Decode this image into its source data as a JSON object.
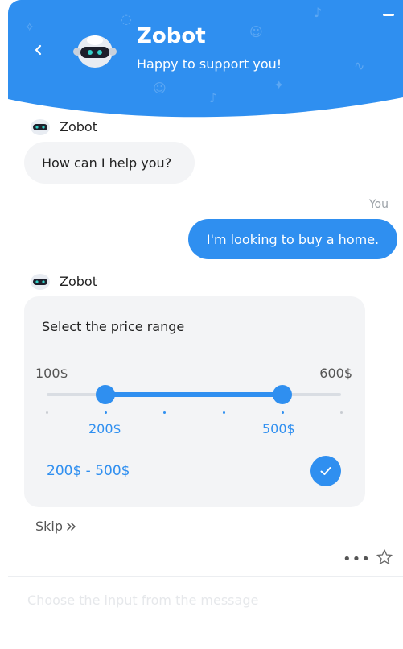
{
  "header": {
    "title": "Zobot",
    "subtitle": "Happy to support you!",
    "back_icon": "chevron-left-icon",
    "minimize_icon": "minimize-icon",
    "color": "#2f8ff0"
  },
  "messages": {
    "bot_name_1": "Zobot",
    "bot_text_1": "How can I help you?",
    "user_label": "You",
    "user_text": "I'm looking to buy a home.",
    "bot_name_2": "Zobot"
  },
  "range": {
    "title": "Select the price range",
    "min_label": "100$",
    "max_label": "600$",
    "min": 100,
    "max": 600,
    "low": 200,
    "high": 500,
    "low_label": "200$",
    "high_label": "500$",
    "summary": "200$ - 500$",
    "ticks": [
      100,
      200,
      300,
      400,
      500,
      600
    ],
    "confirm_icon": "check-icon"
  },
  "actions": {
    "skip_label": "Skip",
    "more_icon": "more-dots-icon",
    "star_icon": "star-icon"
  },
  "composer": {
    "placeholder": "Choose the input from the message"
  },
  "colors": {
    "accent": "#2f8ff0",
    "bubble_bg": "#f3f4f6"
  }
}
